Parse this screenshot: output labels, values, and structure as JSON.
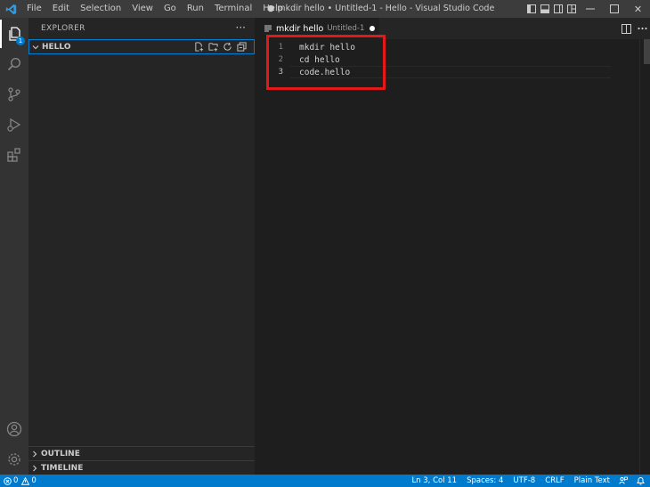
{
  "title_bar": {
    "menu": [
      "File",
      "Edit",
      "Selection",
      "View",
      "Go",
      "Run",
      "Terminal",
      "Help"
    ],
    "title": "● mkdir hello • Untitled-1 - Hello - Visual Studio Code",
    "close": "✕"
  },
  "activity_bar": {
    "explorer_badge": "1"
  },
  "sidebar": {
    "header": "EXPLORER",
    "more": "···",
    "folder": "HELLO",
    "outline": "OUTLINE",
    "timeline": "TIMELINE"
  },
  "editor": {
    "tab": {
      "label": "mkdir hello",
      "description": "Untitled-1"
    },
    "lines": [
      {
        "number": "1",
        "text": "mkdir hello"
      },
      {
        "number": "2",
        "text": "cd hello"
      },
      {
        "number": "3",
        "text": "code.hello"
      }
    ]
  },
  "status_bar": {
    "errors": "0",
    "warnings": "0",
    "position": "Ln 3, Col 11",
    "spaces": "Spaces: 4",
    "encoding": "UTF-8",
    "eol": "CRLF",
    "language": "Plain Text"
  },
  "colors": {
    "accent": "#007acc",
    "highlight_box": "#e11919"
  }
}
